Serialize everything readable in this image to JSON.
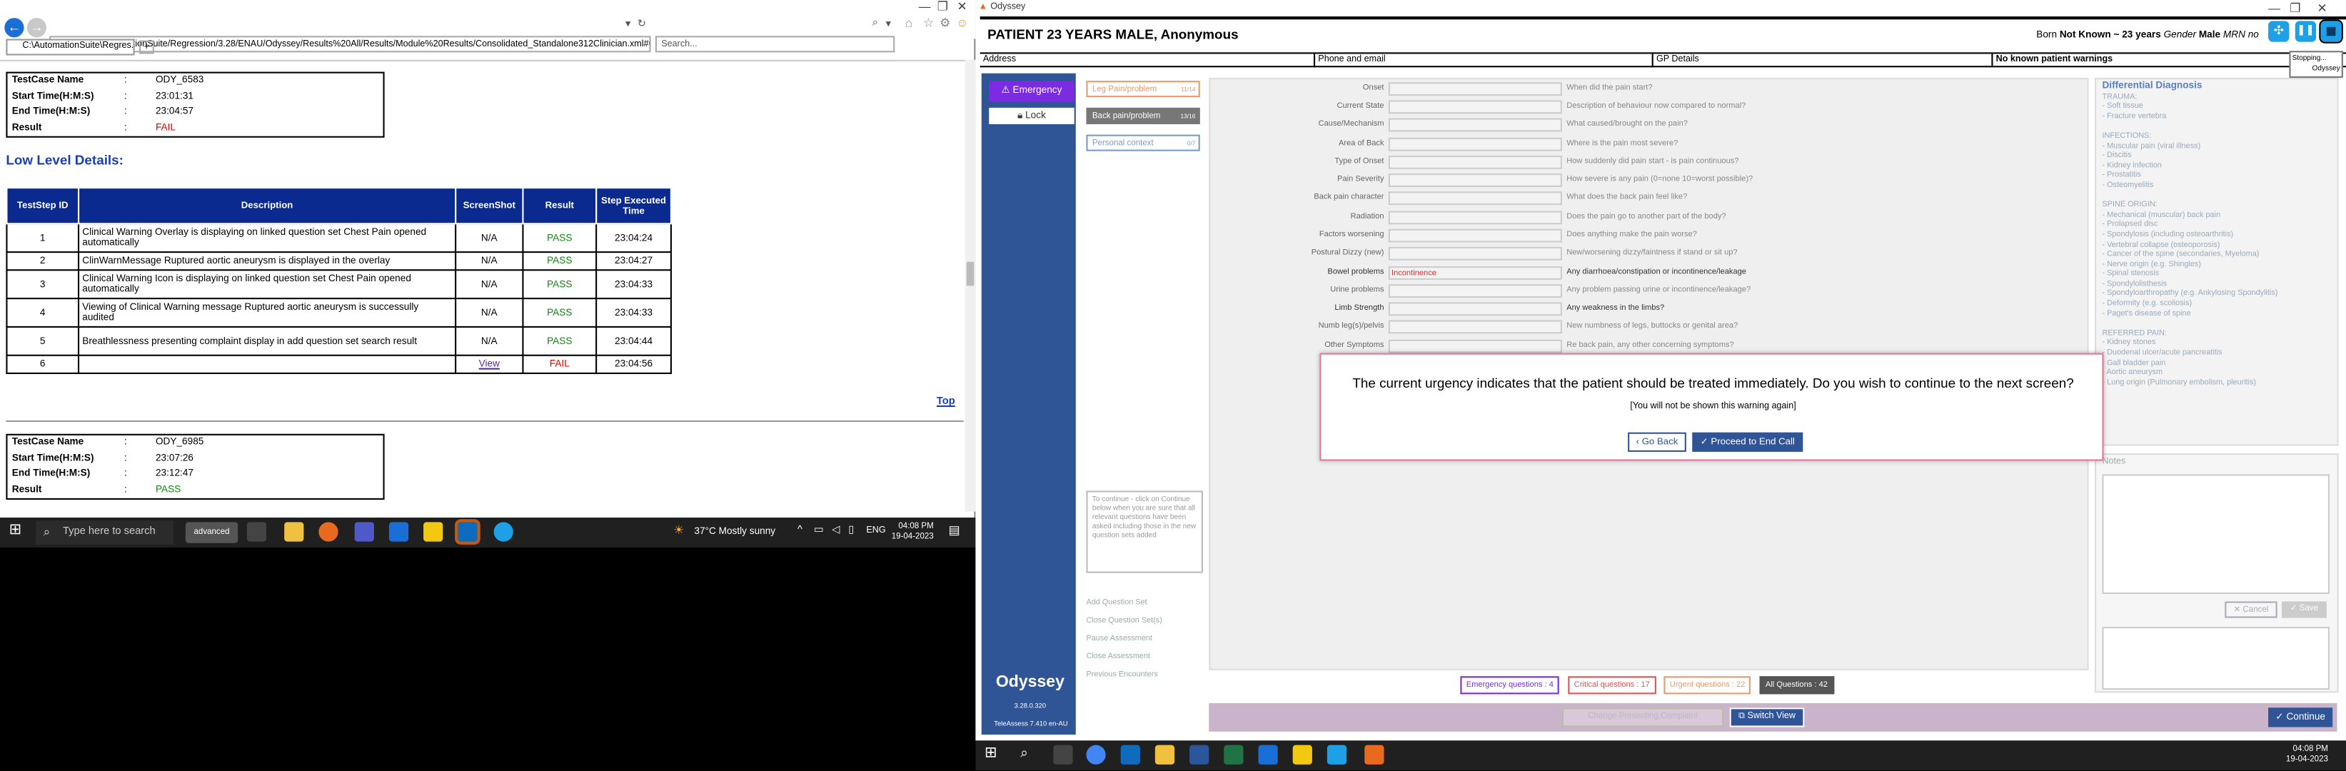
{
  "ie": {
    "address": "file:///C:/AutomationSuite/Regression/3.28/ENAU/Odyssey/Results%20All/Results/Module%20Results/Consolidated_Standalone312Clinician.xml#0",
    "search_placeholder": "Search...",
    "tab_label": "C:\\AutomationSuite\\Regres...",
    "testcase1": {
      "name_label": "TestCase Name",
      "name": "ODY_6583",
      "start_label": "Start Time(H:M:S)",
      "start": "23:01:31",
      "end_label": "End Time(H:M:S)",
      "end": "23:04:57",
      "result_label": "Result",
      "result": "FAIL"
    },
    "low_level_title": "Low Level Details:",
    "table_headers": {
      "id": "TestStep ID",
      "desc": "Description",
      "shot": "ScreenShot",
      "result": "Result",
      "time": "Step Executed Time"
    },
    "steps": [
      {
        "id": "1",
        "desc": "Clinical Warning Overlay is displaying on linked question set Chest Pain opened automatically",
        "shot": "N/A",
        "result": "PASS",
        "time": "23:04:24"
      },
      {
        "id": "2",
        "desc": "ClinWarnMessage Ruptured aortic aneurysm is displayed in the overlay",
        "shot": "N/A",
        "result": "PASS",
        "time": "23:04:27"
      },
      {
        "id": "3",
        "desc": "Clinical Warning Icon is displaying on linked question set Chest Pain opened automatically",
        "shot": "N/A",
        "result": "PASS",
        "time": "23:04:33"
      },
      {
        "id": "4",
        "desc": "Viewing of Clinical Warning message Ruptured aortic aneurysm is successully audited",
        "shot": "N/A",
        "result": "PASS",
        "time": "23:04:33"
      },
      {
        "id": "5",
        "desc": "Breathlessness presenting complaint display in add question set search result",
        "shot": "N/A",
        "result": "PASS",
        "time": "23:04:44"
      },
      {
        "id": "6",
        "desc": "",
        "shot": "View",
        "result": "FAIL",
        "time": "23:04:56"
      }
    ],
    "top_link": "Top",
    "testcase2": {
      "name_label": "TestCase Name",
      "name": "ODY_6985",
      "start_label": "Start Time(H:M:S)",
      "start": "23:07:26",
      "end_label": "End Time(H:M:S)",
      "end": "23:12:47",
      "result_label": "Result",
      "result": "PASS"
    },
    "colon": ":"
  },
  "taskbar_left": {
    "search": "Type here to search",
    "app_label": "advanced",
    "weather": "37°C  Mostly sunny",
    "lang": "ENG",
    "time": "04:08 PM",
    "date": "19-04-2023"
  },
  "odyssey": {
    "window_title": "Odyssey",
    "patient": "PATIENT 23 YEARS MALE, Anonymous",
    "born_label": "Born",
    "born_value": "Not Known ~ 23 years",
    "gender_label": "Gender",
    "gender_value": "Male",
    "mrn_label": "MRN no",
    "stopping_tooltip": "Stopping...",
    "tooltip_app": "Odyssey",
    "info": {
      "address": "Address",
      "phone": "Phone and email",
      "gp": "GP Details",
      "warnings": "No known patient warnings"
    },
    "emergency": "Emergency",
    "lock": "Lock",
    "qsets": [
      {
        "label": "Leg Pain/problem",
        "count": "11/14"
      },
      {
        "label": "Back pain/problem",
        "count": "13/16"
      },
      {
        "label": "Personal context",
        "count": "0/7"
      }
    ],
    "continue_note": "To continue - click on Continue below when you are sure that all relevant questions have been asked including those in the new question sets added",
    "side_links": [
      "Add Question Set",
      "Close Question Set(s)",
      "Pause Assessment",
      "Close Assessment",
      "Previous Encounters"
    ],
    "logo": "Odyssey",
    "version": "3.28.0.320",
    "teleassess": "TeleAssess 7.410 en-AU",
    "questions": [
      {
        "label": "Onset",
        "value": "",
        "prompt": "When did the pain start?"
      },
      {
        "label": "Current State",
        "value": "",
        "prompt": "Description of behaviour now compared to normal?"
      },
      {
        "label": "Cause/Mechanism",
        "value": "",
        "prompt": "What caused/brought on the pain?"
      },
      {
        "label": "Area of Back",
        "value": "",
        "prompt": "Where is the pain most severe?"
      },
      {
        "label": "Type of Onset",
        "value": "",
        "prompt": "How suddenly did pain start - is pain continuous?"
      },
      {
        "label": "Pain Severity",
        "value": "",
        "prompt": "How severe is any pain (0=none 10=worst possible)?"
      },
      {
        "label": "Back pain character",
        "value": "",
        "prompt": "What does the back pain feel like?"
      },
      {
        "label": "Radiation",
        "value": "",
        "prompt": "Does the pain go to another part of the body?"
      },
      {
        "label": "Factors worsening",
        "value": "",
        "prompt": "Does anything make the pain worse?"
      },
      {
        "label": "Postural Dizzy (new)",
        "value": "",
        "prompt": "New/worsening dizzy/faintness if stand or sit up?"
      },
      {
        "label": "Bowel problems",
        "value": "Incontinence",
        "prompt": "Any diarrhoea/constipation or incontinence/leakage"
      },
      {
        "label": "Urine problems",
        "value": "",
        "prompt": "Any problem passing urine or incontinence/leakage?"
      },
      {
        "label": "Limb Strength",
        "value": "",
        "prompt": "Any weakness in the limbs?"
      },
      {
        "label": "Numb leg(s)/pelvis",
        "value": "",
        "prompt": "New numbness of legs, buttocks or genital area?"
      },
      {
        "label": "Other Symptoms",
        "value": "",
        "prompt": "Re back pain, any other concerning symptoms?"
      }
    ],
    "ddx_title": "Differential Diagnosis",
    "ddx": [
      "TRAUMA:",
      "- Soft tissue",
      "- Fracture vertebra",
      "",
      "INFECTIONS:",
      "- Muscular pain (viral illness)",
      "- Discitis",
      "- Kidney infection",
      "- Prostatitis",
      "- Osteomyelitis",
      "",
      "SPINE ORIGIN:",
      "- Mechanical (muscular) back pain",
      "- Prolapsed disc",
      "- Spondylosis (including osteoarthritis)",
      "- Vertebral collapse (osteoporosis)",
      "- Cancer of the spine (secondaries, Myeloma)",
      "- Nerve origin (e.g. Shingles)",
      "- Spinal stenosis",
      "- Spondylolisthesis",
      "- Spondyloarthropathy (e.g. Ankylosing Spondylitis)",
      "- Deformity (e.g. scoliosis)",
      "- Paget's disease of spine",
      "",
      "REFERRED PAIN:",
      "- Kidney stones",
      "- Duodenal ulcer/acute pancreatitis",
      "- Gall bladder pain",
      "- Aortic aneurysm",
      "- Lung origin (Pulmonary embolism, pleuritis)"
    ],
    "notes_label": "Notes",
    "notes_cancel": "Cancel",
    "notes_save": "Save",
    "counts": {
      "emergency": "Emergency questions : 4",
      "critical": "Critical questions : 17",
      "urgent": "Urgent questions : 22",
      "all": "All Questions : 42"
    },
    "change_presenting": "Change Presenting Complaint",
    "switch_view": "Switch View",
    "continue": "Continue",
    "dialog": {
      "message": "The current urgency indicates that the patient should be treated immediately. Do you wish to continue to the next screen?",
      "sub": "[You will not be shown this warning again]",
      "back": "Go Back",
      "proceed": "Proceed to End Call"
    }
  },
  "taskbar_right": {
    "time": "04:08 PM",
    "date": "19-04-2023"
  },
  "colors": {
    "ie_blue": "#0b2a8f",
    "ody_sidebar": "#2f5597",
    "emergency": "#7b2be2",
    "pass": "#0a8a0a",
    "fail": "#e00000"
  }
}
